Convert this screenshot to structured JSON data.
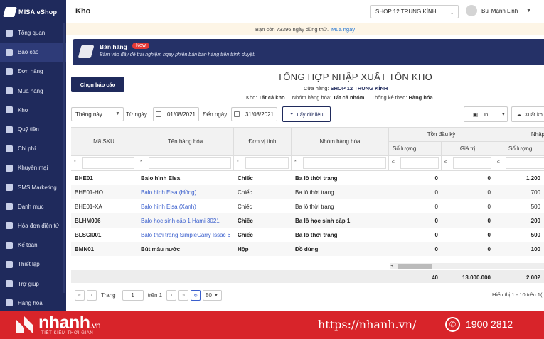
{
  "app": {
    "logo": "MISA eShop",
    "page_title": "Kho"
  },
  "topbar": {
    "store": "SHOP 12 TRUNG KÍNH",
    "user": "Bùi Mạnh Linh"
  },
  "notice": {
    "text": "Bạn còn 73396 ngày dùng thử.",
    "link": "Mua ngay"
  },
  "sidebar": {
    "items": [
      {
        "label": "Tổng quan",
        "icon": "dashboard-icon"
      },
      {
        "label": "Báo cáo",
        "icon": "report-icon"
      },
      {
        "label": "Đơn hàng",
        "icon": "order-icon"
      },
      {
        "label": "Mua hàng",
        "icon": "cart-icon"
      },
      {
        "label": "Kho",
        "icon": "warehouse-icon"
      },
      {
        "label": "Quỹ tiền",
        "icon": "cash-icon"
      },
      {
        "label": "Chi phí",
        "icon": "expense-icon"
      },
      {
        "label": "Khuyến mại",
        "icon": "promotion-icon"
      },
      {
        "label": "SMS Marketing",
        "icon": "sms-icon"
      },
      {
        "label": "Danh mục",
        "icon": "category-icon"
      },
      {
        "label": "Hóa đơn điện tử",
        "icon": "invoice-icon"
      },
      {
        "label": "Kế toán",
        "icon": "accounting-icon"
      },
      {
        "label": "Thiết lập",
        "icon": "settings-icon"
      },
      {
        "label": "Trợ giúp",
        "icon": "help-icon"
      },
      {
        "label": "Hàng hóa",
        "icon": "goods-icon"
      }
    ]
  },
  "banner": {
    "title": "Bán hàng",
    "badge": "New",
    "desc": "Bấm vào đây để trải nghiệm ngay phiên bản bán hàng trên trình duyệt."
  },
  "report": {
    "choose_button": "Chọn báo cáo",
    "title": "TỔNG HỢP NHẬP XUẤT TỒN KHO",
    "store_label": "Cửa hàng:",
    "store_value": "SHOP 12 TRUNG KÍNH",
    "warehouse_label": "Kho:",
    "warehouse_value": "Tất cả kho",
    "group_label": "Nhóm hàng hóa:",
    "group_value": "Tất cả nhóm",
    "stat_label": "Thống kê theo:",
    "stat_value": "Hàng hóa"
  },
  "filters": {
    "period": "Tháng này",
    "from_label": "Từ ngày",
    "from_date": "01/08/2021",
    "to_label": "Đến ngày",
    "to_date": "31/08/2021",
    "load_button": "Lấy dữ liệu",
    "print_button": "In",
    "export_button": "Xuất kh"
  },
  "table": {
    "headers": {
      "sku": "Mã SKU",
      "name": "Tên hàng hóa",
      "unit": "Đơn vị tính",
      "group": "Nhóm hàng hóa",
      "opening": "Tồn đầu kỳ",
      "opening_qty": "Số lượng",
      "opening_val": "Giá trị",
      "import": "Nhập",
      "import_qty": "Số lượng"
    },
    "filter_ops": [
      "*",
      "*",
      "*",
      "*",
      "≤",
      "≤",
      "≤"
    ],
    "rows": [
      {
        "sku": "BHE01",
        "name": "Balo hình Elsa",
        "unit": "Chiếc",
        "group": "Ba lô thời trang",
        "qty": "0",
        "val": "0",
        "imp": "1.200",
        "bold": true
      },
      {
        "sku": "BHE01-HO",
        "name": "Balo hình Elsa (Hồng)",
        "unit": "Chiếc",
        "group": "Ba lô thời trang",
        "qty": "0",
        "val": "0",
        "imp": "700",
        "bold": false
      },
      {
        "sku": "BHE01-XA",
        "name": "Balo hình Elsa (Xanh)",
        "unit": "Chiếc",
        "group": "Ba lô thời trang",
        "qty": "0",
        "val": "0",
        "imp": "500",
        "bold": false
      },
      {
        "sku": "BLHM006",
        "name": "Balo học sinh cấp 1 Hami 3021",
        "unit": "Chiếc",
        "group": "Ba lô học sinh cấp 1",
        "qty": "0",
        "val": "0",
        "imp": "200",
        "bold": true
      },
      {
        "sku": "BLSCI001",
        "name": "Balo thời trang SimpleCarry Issac 6",
        "unit": "Chiếc",
        "group": "Ba lô thời trang",
        "qty": "0",
        "val": "0",
        "imp": "500",
        "bold": true
      },
      {
        "sku": "BMN01",
        "name": "Bút màu nước",
        "unit": "Hộp",
        "group": "Đồ dùng",
        "qty": "0",
        "val": "0",
        "imp": "100",
        "bold": true
      }
    ],
    "totals": {
      "qty": "40",
      "val": "13.000.000",
      "imp": "2.002"
    }
  },
  "pager": {
    "page_label": "Trang",
    "page": "1",
    "of_label": "trên 1",
    "page_size": "50",
    "info": "Hiển thị 1 - 10 trên 1("
  },
  "footer": {
    "brand": "nhanh",
    "brand_suffix": ".vn",
    "tagline": "TIẾT KIỆM THỜI GIAN",
    "url": "https://nhanh.vn/",
    "phone": "1900 2812"
  }
}
